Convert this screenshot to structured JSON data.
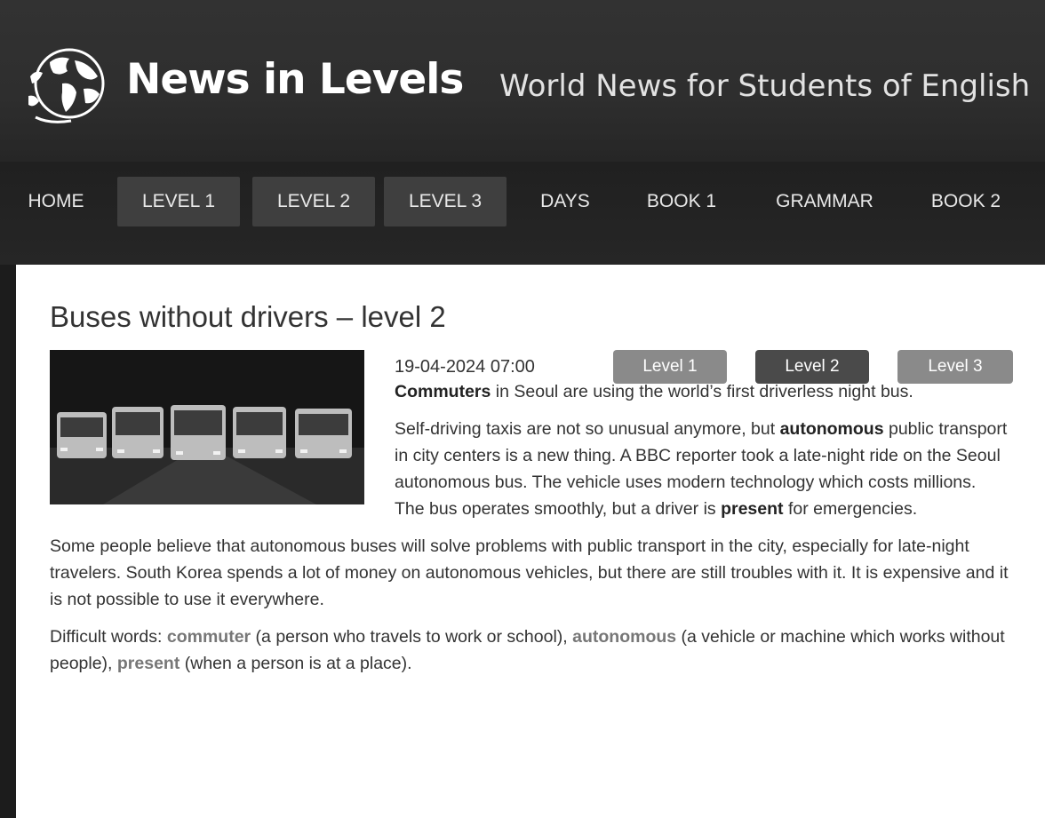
{
  "header": {
    "site_title": "News in Levels",
    "tagline": "World News for Students of English"
  },
  "nav": {
    "items": [
      {
        "label": "HOME"
      },
      {
        "label": "LEVEL 1"
      },
      {
        "label": "LEVEL 2"
      },
      {
        "label": "LEVEL 3"
      },
      {
        "label": "DAYS"
      },
      {
        "label": "BOOK 1"
      },
      {
        "label": "GRAMMAR"
      },
      {
        "label": "BOOK 2"
      }
    ]
  },
  "article": {
    "title": "Buses without drivers – level 2",
    "date": "19-04-2024 07:00",
    "level_buttons": [
      {
        "label": "Level 1",
        "color": "#8a8a8a"
      },
      {
        "label": "Level 2",
        "color": "#4a4a4a"
      },
      {
        "label": "Level 3",
        "color": "#8a8a8a"
      }
    ],
    "p1": {
      "bold_word": "Commuters",
      "rest": " in Seoul are using the world’s first driverless night bus."
    },
    "p2": {
      "before": "Self-driving taxis are not so unusual anymore, but ",
      "bold1": "autonomous",
      "middle": " public transport in city centers is a new thing. A BBC reporter took a late-night ride on the Seoul autonomous bus. The vehicle uses modern technology which costs millions. The bus operates smoothly, but a driver is ",
      "bold2": "present",
      "after": " for emergencies."
    },
    "p3": "Some people believe that autonomous buses will solve problems with public transport in the city, especially for late-night travelers. South Korea spends a lot of money on autonomous vehicles, but there are still troubles with it. It is expensive and it is not possible to use it everywhere.",
    "difficult_words": {
      "intro": "Difficult words: ",
      "w1": "commuter",
      "d1": " (a person who travels to work or school), ",
      "w2": "autonomous",
      "d2": " (a vehicle or machine which works without people), ",
      "w3": "present",
      "d3": " (when a person is at a place)."
    }
  },
  "icons": {
    "logo": "globe-logo-icon"
  },
  "colors": {
    "header_bg": "#2e2e2e",
    "nav_bg": "#222222",
    "nav_highlight": "#3f3f3f",
    "highlight_word": "#777777"
  }
}
